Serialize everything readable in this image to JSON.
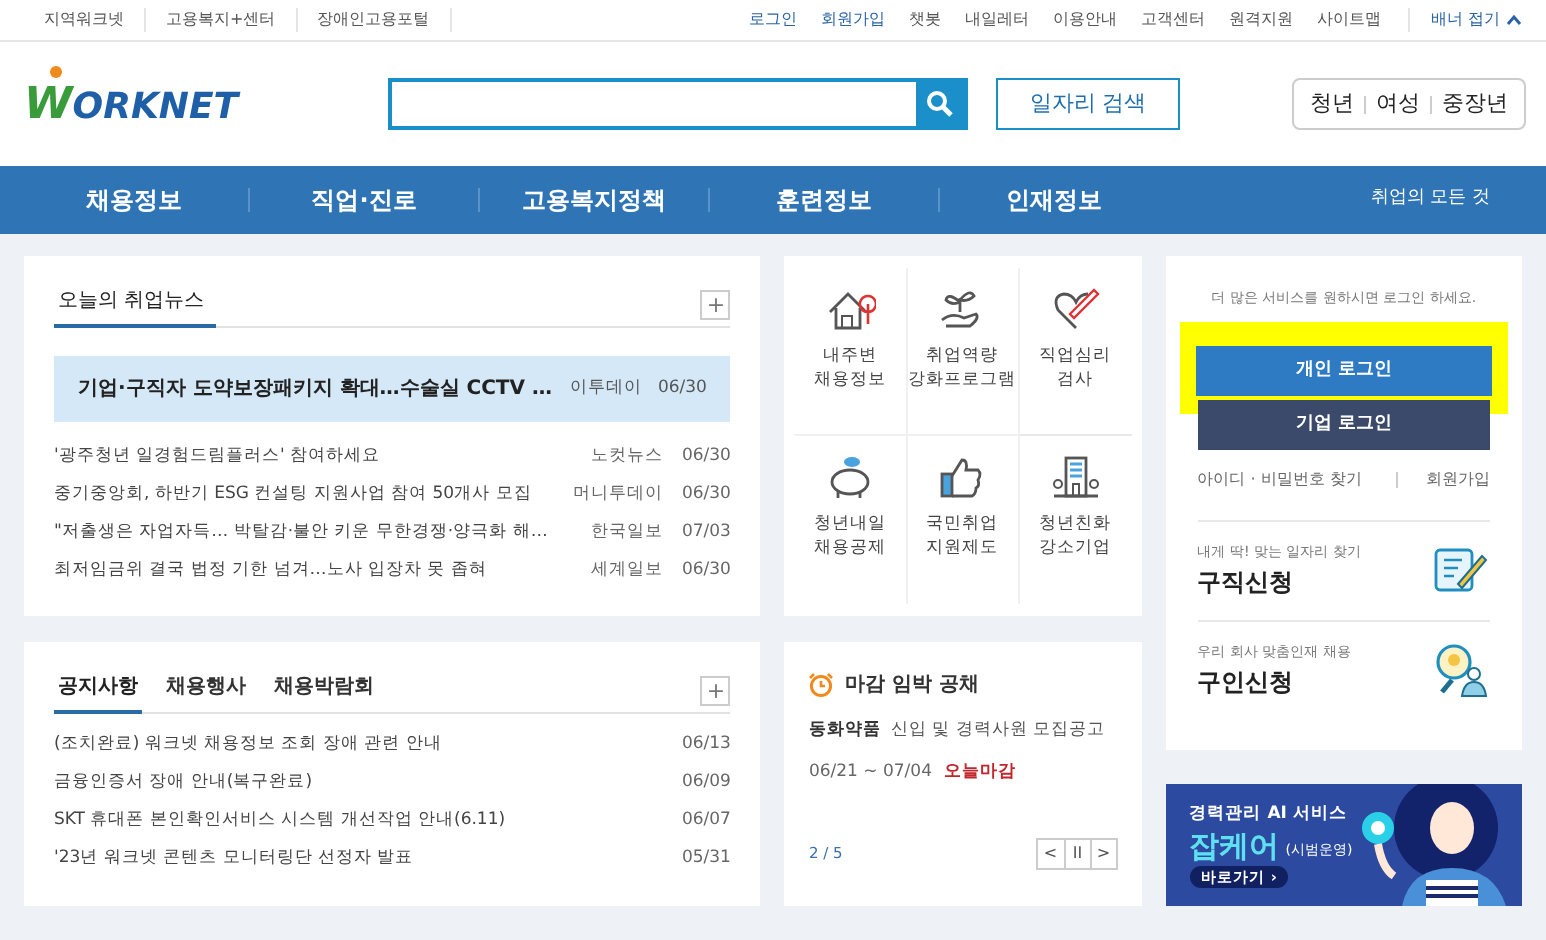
{
  "top_bar": {
    "left_links": [
      "지역워크넷",
      "고용복지+센터",
      "장애인고용포털"
    ],
    "right_links": [
      "로그인",
      "회원가입",
      "챗봇",
      "내일레터",
      "이용안내",
      "고객센터",
      "원격지원",
      "사이트맵"
    ],
    "banner_toggle": "배너 접기"
  },
  "header": {
    "logo": "WORKNET",
    "job_search_button": "일자리 검색",
    "audience_links": [
      "청년",
      "여성",
      "중장년"
    ]
  },
  "nav": {
    "items": [
      "채용정보",
      "직업·진로",
      "고용복지정책",
      "훈련정보",
      "인재정보"
    ],
    "right_link": "취업의 모든 것"
  },
  "news": {
    "title": "오늘의 취업뉴스",
    "more": "+",
    "headline": {
      "title": "기업·구직자 도약보장패키지 확대…수술실 CCTV …",
      "source": "이투데이",
      "date": "06/30"
    },
    "items": [
      {
        "title": "'광주청년 일경험드림플러스' 참여하세요",
        "source": "노컷뉴스",
        "date": "06/30"
      },
      {
        "title": "중기중앙회, 하반기 ESG 컨설팅 지원사업 참여 50개사 모집",
        "source": "머니투데이",
        "date": "06/30"
      },
      {
        "title": "\"저출생은 자업자득… 박탈감·불안 키운 무한경쟁·양극화 해…",
        "source": "한국일보",
        "date": "07/03"
      },
      {
        "title": "최저임금위 결국 법정 기한 넘겨…노사 입장차 못 좁혀",
        "source": "세계일보",
        "date": "06/30"
      }
    ]
  },
  "services": [
    {
      "kind": "house",
      "label": "내주변\n채용정보"
    },
    {
      "kind": "sprout",
      "label": "취업역량\n강화프로그램"
    },
    {
      "kind": "heart",
      "label": "직업심리\n검사"
    },
    {
      "kind": "piggy",
      "label": "청년내일\n채용공제"
    },
    {
      "kind": "thumb",
      "label": "국민취업\n지원제도"
    },
    {
      "kind": "building",
      "label": "청년친화\n강소기업"
    }
  ],
  "login": {
    "prompt": "더 많은 서비스를 원하시면 로그인 하세요.",
    "personal_button": "개인 로그인",
    "highlighted": true,
    "company_button": "기업 로그인",
    "find_link": "아이디 · 비밀번호 찾기",
    "join_link": "회원가입",
    "promos": [
      {
        "kind": "job",
        "caption": "내게 딱! 맞는 일자리 찾기",
        "title": "구직신청"
      },
      {
        "kind": "talent",
        "caption": "우리 회사 맞춤인재 채용",
        "title": "구인신청"
      }
    ]
  },
  "notices": {
    "tabs": [
      {
        "label": "공지사항",
        "selected": true
      },
      {
        "label": "채용행사",
        "selected": false
      },
      {
        "label": "채용박람회",
        "selected": false
      }
    ],
    "more": "+",
    "items": [
      {
        "title": "(조치완료) 워크넷 채용정보 조회 장애 관련 안내",
        "date": "06/13"
      },
      {
        "title": "금융인증서 장애 안내(복구완료)",
        "date": "06/09"
      },
      {
        "title": "SKT 휴대폰 본인확인서비스 시스템 개선작업 안내(6.11)",
        "date": "06/07"
      },
      {
        "title": "'23년 워크넷 콘텐츠 모니터링단 선정자 발표",
        "date": "05/31"
      }
    ]
  },
  "deadline": {
    "title": "마감 임박 공채",
    "company": "동화약품",
    "job": "신입 및 경력사원 모집공고",
    "period": "06/21 ~ 07/04",
    "status": "오늘마감",
    "page": "2 / 5",
    "controls": [
      "<",
      "II",
      ">"
    ]
  },
  "ad_banner": {
    "line1": "경력관리 AI 서비스",
    "brand": "잡케어",
    "note": "(시범운영)",
    "button": "바로가기 ›"
  }
}
